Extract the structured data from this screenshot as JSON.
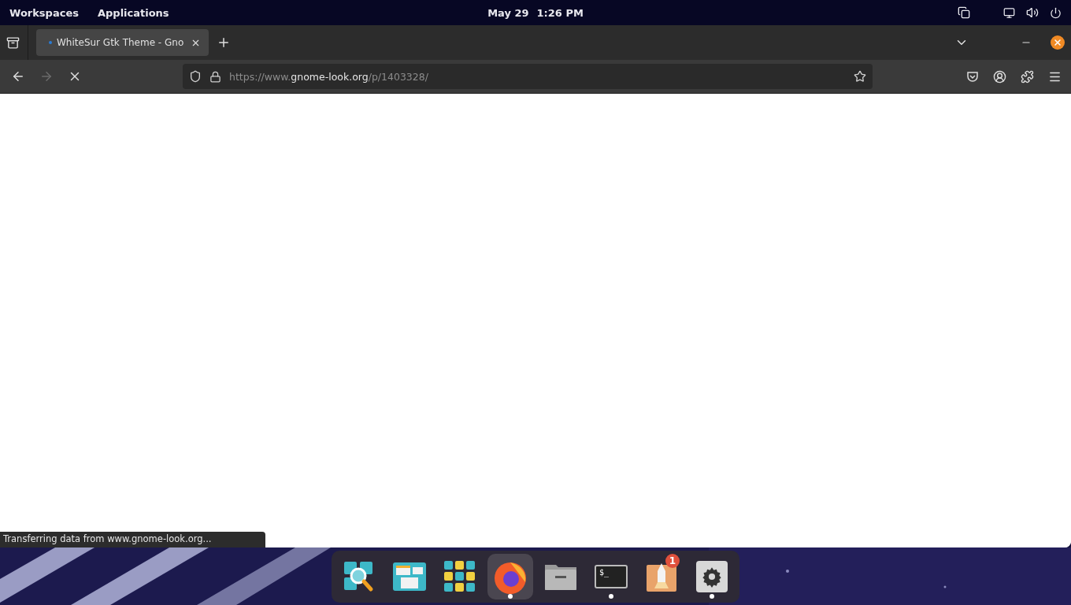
{
  "top_bar": {
    "menus": [
      "Workspaces",
      "Applications"
    ],
    "date": "May 29",
    "time": "1:26 PM"
  },
  "tabs": [
    {
      "title": "WhiteSur Gtk Theme - Gno",
      "selected": true
    }
  ],
  "nav": [
    {
      "kind": "back",
      "disabled": false
    },
    {
      "kind": "forward",
      "disabled": true
    },
    {
      "kind": "stop",
      "disabled": false
    }
  ],
  "url": {
    "scheme": "https://www.",
    "domain": "gnome-look.org",
    "path": "/p/1403328/"
  },
  "status": "Transferring data from www.gnome-look.org...",
  "dock": [
    {
      "kind": "search",
      "running": false,
      "selected": false
    },
    {
      "kind": "windows",
      "running": false,
      "selected": false
    },
    {
      "kind": "grid",
      "running": false,
      "selected": false
    },
    {
      "kind": "firefox",
      "running": true,
      "selected": true
    },
    {
      "kind": "files",
      "running": false,
      "selected": false
    },
    {
      "kind": "terminal",
      "running": true,
      "selected": false,
      "glyph": "$_"
    },
    {
      "kind": "rocket",
      "running": false,
      "selected": false,
      "badge": "1"
    },
    {
      "kind": "settings",
      "running": true,
      "selected": false
    }
  ]
}
